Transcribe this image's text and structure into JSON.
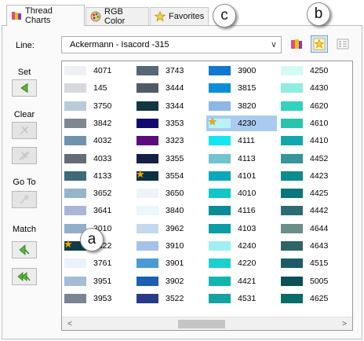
{
  "tabs": [
    {
      "label": "Thread Charts",
      "icon": "thread-spools-icon",
      "active": true
    },
    {
      "label": "RGB Color",
      "icon": "palette-icon",
      "active": false
    },
    {
      "label": "Favorites",
      "icon": "star-icon",
      "active": false
    }
  ],
  "callouts": {
    "a": "a",
    "b": "b",
    "c": "c"
  },
  "line": {
    "label": "Line:",
    "value": "Ackermann - Isacord -315"
  },
  "toolbar": {
    "icons": [
      "thread-chart-icon",
      "favorite-star-icon",
      "list-view-icon"
    ]
  },
  "side": {
    "set": "Set",
    "clear": "Clear",
    "goto": "Go To",
    "match": "Match"
  },
  "accent": "#f2a900",
  "columns": [
    [
      {
        "code": "4071",
        "color": "#eef0f3"
      },
      {
        "code": "145",
        "color": "#d6d8dc"
      },
      {
        "code": "3750",
        "color": "#b9cbd9"
      },
      {
        "code": "3842",
        "color": "#7e8791"
      },
      {
        "code": "4032",
        "color": "#6f93ad"
      },
      {
        "code": "4033",
        "color": "#656d74"
      },
      {
        "code": "4133",
        "color": "#3f6a79"
      },
      {
        "code": "3652",
        "color": "#95b5cc"
      },
      {
        "code": "3641",
        "color": "#a9b6d8"
      },
      {
        "code": "3010",
        "color": "#93aec9"
      },
      {
        "code": "3322",
        "color": "#0e3d46",
        "fav": true
      },
      {
        "code": "3761",
        "color": "#eaf3fb"
      },
      {
        "code": "3951",
        "color": "#a5bcd6"
      },
      {
        "code": "3953",
        "color": "#7a8492"
      }
    ],
    [
      {
        "code": "3743",
        "color": "#556778"
      },
      {
        "code": "3444",
        "color": "#4f5a66"
      },
      {
        "code": "3344",
        "color": "#123744"
      },
      {
        "code": "3353",
        "color": "#110a6e"
      },
      {
        "code": "3323",
        "color": "#5b0b7a"
      },
      {
        "code": "3355",
        "color": "#152142"
      },
      {
        "code": "3554",
        "color": "#0d3144",
        "fav": true
      },
      {
        "code": "3650",
        "color": "#eef3f8"
      },
      {
        "code": "3840",
        "color": "#eaf7fb"
      },
      {
        "code": "3962",
        "color": "#c2d9ee"
      },
      {
        "code": "3910",
        "color": "#a5c2e8"
      },
      {
        "code": "3901",
        "color": "#4a9bd4"
      },
      {
        "code": "3902",
        "color": "#1a5fb4"
      },
      {
        "code": "3522",
        "color": "#263b8a"
      }
    ],
    [
      {
        "code": "3900",
        "color": "#0f79d2"
      },
      {
        "code": "3815",
        "color": "#0a8ed8"
      },
      {
        "code": "3820",
        "color": "#8eb7e6"
      },
      {
        "code": "4230",
        "color": "#b8f3f6",
        "fav": true,
        "selected": true
      },
      {
        "code": "4111",
        "color": "#14e6f2"
      },
      {
        "code": "4113",
        "color": "#73c2cf"
      },
      {
        "code": "4101",
        "color": "#0ba8bd"
      },
      {
        "code": "4010",
        "color": "#10c7c7"
      },
      {
        "code": "4116",
        "color": "#0d8c97"
      },
      {
        "code": "4103",
        "color": "#0b9ca4"
      },
      {
        "code": "4240",
        "color": "#9ff0f2"
      },
      {
        "code": "4220",
        "color": "#1bd1cf"
      },
      {
        "code": "4421",
        "color": "#0fb6b0"
      },
      {
        "code": "4531",
        "color": "#14a3a0"
      }
    ],
    [
      {
        "code": "4250",
        "color": "#d3fbf5"
      },
      {
        "code": "4430",
        "color": "#8deee0"
      },
      {
        "code": "4620",
        "color": "#33d2bc"
      },
      {
        "code": "4610",
        "color": "#2ac3ad"
      },
      {
        "code": "4410",
        "color": "#11a7ad"
      },
      {
        "code": "4452",
        "color": "#36969b"
      },
      {
        "code": "4423",
        "color": "#0c8c8c"
      },
      {
        "code": "4425",
        "color": "#08767a"
      },
      {
        "code": "4442",
        "color": "#2b6c73"
      },
      {
        "code": "4644",
        "color": "#6b8e8a"
      },
      {
        "code": "4643",
        "color": "#2f6468"
      },
      {
        "code": "4515",
        "color": "#1b5c68"
      },
      {
        "code": "5005",
        "color": "#0a5157"
      },
      {
        "code": "4625",
        "color": "#0a6c68"
      }
    ]
  ],
  "scroll": {
    "left": "<",
    "right": ">"
  }
}
